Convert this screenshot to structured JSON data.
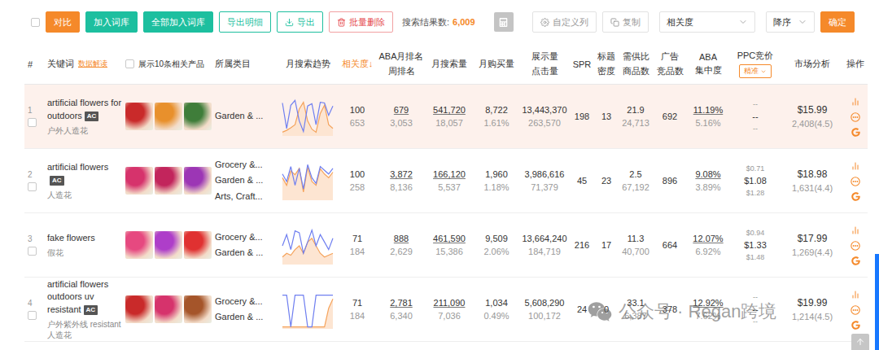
{
  "toolbar": {
    "select_all": {
      "checked": false
    },
    "buttons": [
      {
        "label": "对比",
        "kind": "orange"
      },
      {
        "label": "加入词库",
        "kind": "teal"
      },
      {
        "label": "全部加入词库",
        "kind": "teal"
      },
      {
        "label": "导出明细",
        "kind": "outline"
      },
      {
        "label": "导出",
        "kind": "export"
      },
      {
        "label": "批量删除",
        "kind": "danger"
      }
    ],
    "result_label": "搜索结果数:",
    "result_count": "6,009",
    "tools": [
      {
        "label": "自定义列",
        "kind": "settings"
      },
      {
        "label": "复制",
        "kind": "copy"
      }
    ],
    "sort_field": "相关度",
    "sort_order": "降序",
    "confirm": "确定"
  },
  "table": {
    "columns": [
      {
        "lines": [
          "#"
        ],
        "kind": "index",
        "sorted": false
      },
      {
        "lines": [
          "关键词"
        ],
        "note": "数据解读",
        "kind": "keyword",
        "sorted": false
      },
      {
        "lines": [
          "展示10条相关产品"
        ],
        "kind": "toggle",
        "checked": false,
        "sorted": false
      },
      {
        "lines": [
          "所属类目"
        ],
        "kind": "category",
        "sorted": false
      },
      {
        "lines": [
          "月搜索趋势"
        ],
        "kind": "trend",
        "sorted": false
      },
      {
        "lines": [
          "相关度↓"
        ],
        "kind": "number",
        "sorted": true
      },
      {
        "lines": [
          "ABA月排名",
          "周排名"
        ],
        "kind": "number",
        "sorted": false
      },
      {
        "lines": [
          "月搜索量"
        ],
        "kind": "number",
        "sorted": false
      },
      {
        "lines": [
          "月购买量"
        ],
        "kind": "number",
        "sorted": false
      },
      {
        "lines": [
          "展示量",
          "点击量"
        ],
        "kind": "number",
        "sorted": false
      },
      {
        "lines": [
          "SPR"
        ],
        "kind": "number",
        "sorted": false
      },
      {
        "lines": [
          "标题",
          "密度"
        ],
        "kind": "number",
        "sorted": false
      },
      {
        "lines": [
          "需供比",
          "商品数"
        ],
        "kind": "number",
        "sorted": false
      },
      {
        "lines": [
          "广告",
          "竞品数"
        ],
        "kind": "number",
        "sorted": false
      },
      {
        "lines": [
          "ABA",
          "集中度"
        ],
        "kind": "number",
        "sorted": false
      },
      {
        "lines": [
          "PPC竞价"
        ],
        "kind": "ppc",
        "mode": "精准",
        "sorted": false
      },
      {
        "lines": [
          "市场分析"
        ],
        "kind": "number",
        "sorted": false
      },
      {
        "lines": [
          "操作"
        ],
        "kind": "number",
        "sorted": false
      }
    ],
    "rows": [
      {
        "index": "1",
        "checked": false,
        "selected": true,
        "keyword": "artificial flowers for outdoors",
        "badge": "AC",
        "translation": "户外人造花",
        "products": [
          {
            "color": "#c92a2a"
          },
          {
            "color": "#e8902c"
          },
          {
            "color": "#3f7d3a"
          }
        ],
        "categories": [
          "Garden & ..."
        ],
        "trend": {
          "blue": [
            88,
            20,
            82,
            95,
            40,
            12,
            80,
            86,
            30,
            90,
            88,
            55,
            80
          ],
          "orange": [
            10,
            15,
            22,
            30,
            72,
            90,
            40,
            18,
            10,
            60,
            82,
            30,
            20
          ]
        },
        "relevance": {
          "value": "100",
          "sub": "653"
        },
        "aba": {
          "value": "679",
          "sub": "3,053"
        },
        "search_volume": {
          "value": "541,720",
          "sub": "18,057"
        },
        "purchases": {
          "value": "8,722",
          "sub": "1.61%"
        },
        "impressions": {
          "value": "13,443,370",
          "sub": "263,570"
        },
        "spr": "198",
        "title_density": "13",
        "supply_demand": {
          "value": "21.9",
          "sub": "24,713"
        },
        "ad_competitors": "692",
        "aba_concentration": {
          "value": "11.19%",
          "sub": "5.16%"
        },
        "ppc": [
          "--",
          "--",
          "--"
        ],
        "market": {
          "price": "$15.99",
          "reviews": "2,408(4.5)"
        }
      },
      {
        "index": "2",
        "checked": false,
        "selected": false,
        "keyword": "artificial flowers",
        "badge": "AC",
        "translation": "人造花",
        "products": [
          {
            "color": "#d6336c"
          },
          {
            "color": "#c2255c"
          },
          {
            "color": "#9c36b5"
          }
        ],
        "categories": [
          "Grocery &...",
          "Garden & ...",
          "Arts, Craft..."
        ],
        "trend": {
          "blue": [
            70,
            50,
            90,
            40,
            85,
            30,
            95,
            60,
            45,
            90,
            80,
            70,
            85
          ],
          "orange": [
            60,
            40,
            78,
            68,
            85,
            22,
            88,
            50,
            40,
            84,
            70,
            60,
            75
          ]
        },
        "relevance": {
          "value": "100",
          "sub": "258"
        },
        "aba": {
          "value": "3,872",
          "sub": "8,136"
        },
        "search_volume": {
          "value": "166,120",
          "sub": "5,537"
        },
        "purchases": {
          "value": "1,960",
          "sub": "1.18%"
        },
        "impressions": {
          "value": "3,986,616",
          "sub": "71,379"
        },
        "spr": "45",
        "title_density": "23",
        "supply_demand": {
          "value": "2.5",
          "sub": "67,192"
        },
        "ad_competitors": "896",
        "aba_concentration": {
          "value": "9.08%",
          "sub": "3.89%"
        },
        "ppc": [
          "$0.71",
          "$1.08",
          "$1.28"
        ],
        "market": {
          "price": "$18.98",
          "reviews": "1,631(4.4)"
        }
      },
      {
        "index": "3",
        "checked": false,
        "selected": false,
        "keyword": "fake flowers",
        "badge": "",
        "translation": "假花",
        "products": [
          {
            "color": "#e64980"
          },
          {
            "color": "#ae3ec9"
          },
          {
            "color": "#e03131"
          }
        ],
        "categories": [
          "Grocery &...",
          "Garden & ..."
        ],
        "trend": {
          "blue": [
            50,
            80,
            40,
            90,
            85,
            30,
            60,
            92,
            50,
            80,
            60,
            40,
            70
          ],
          "orange": [
            20,
            30,
            25,
            40,
            50,
            30,
            60,
            70,
            50,
            30,
            20,
            25,
            30
          ]
        },
        "relevance": {
          "value": "71",
          "sub": "184"
        },
        "aba": {
          "value": "888",
          "sub": "2,629"
        },
        "search_volume": {
          "value": "461,590",
          "sub": "15,386"
        },
        "purchases": {
          "value": "9,509",
          "sub": "2.06%"
        },
        "impressions": {
          "value": "13,664,240",
          "sub": "184,719"
        },
        "spr": "216",
        "title_density": "17",
        "supply_demand": {
          "value": "11.3",
          "sub": "40,700"
        },
        "ad_competitors": "664",
        "aba_concentration": {
          "value": "12.07%",
          "sub": "6.92%"
        },
        "ppc": [
          "$0.94",
          "$1.33",
          "$1.48"
        ],
        "market": {
          "price": "$17.99",
          "reviews": "1,269(4.4)"
        }
      },
      {
        "index": "4",
        "checked": false,
        "selected": false,
        "keyword": "artificial flowers outdoors uv resistant",
        "badge": "AC",
        "translation": "户外紫外线 resistant 人造花",
        "products": [
          {
            "color": "#c92a2a"
          },
          {
            "color": "#d6336c"
          },
          {
            "color": "#a5552a"
          }
        ],
        "categories": [
          "Grocery &...",
          "Garden & ..."
        ],
        "trend": {
          "blue": [
            90,
            90,
            5,
            90,
            90,
            90,
            5,
            5,
            90,
            90,
            90,
            90,
            90
          ],
          "orange": [
            5,
            5,
            5,
            5,
            5,
            5,
            5,
            5,
            5,
            5,
            5,
            55,
            80
          ]
        },
        "relevance": {
          "value": "71",
          "sub": "184"
        },
        "aba": {
          "value": "2,781",
          "sub": "6,340"
        },
        "search_volume": {
          "value": "211,090",
          "sub": "7,036"
        },
        "purchases": {
          "value": "1,034",
          "sub": "0.49%"
        },
        "impressions": {
          "value": "5,608,290",
          "sub": "100,172"
        },
        "spr": "24",
        "title_density": "0",
        "supply_demand": {
          "value": "33.1",
          "sub": "6,387"
        },
        "ad_competitors": "378",
        "aba_concentration": {
          "value": "12.92%",
          "sub": "7.62%"
        },
        "ppc": [
          "--",
          "--",
          "--"
        ],
        "market": {
          "price": "$19.99",
          "reviews": "1,214(4.5)"
        }
      }
    ]
  },
  "watermark": "公众号 · Regan跨境"
}
